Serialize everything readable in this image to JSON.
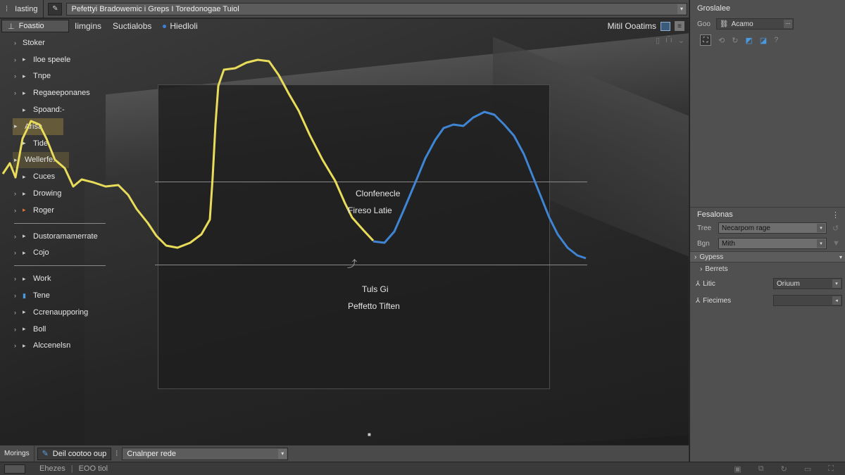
{
  "topbar": {
    "app_label": "Iasting",
    "pin_icon": "pin-icon",
    "title": "Pefettyi Bradowemic i Greps I Toredonogae Tuiol"
  },
  "viewport_tabs": {
    "active_tab": "Foastio",
    "tabs": [
      "Iimgins",
      "Suctialobs",
      "Hiedloli"
    ],
    "right_label": "Mitil Ooatims"
  },
  "tree": {
    "items": [
      {
        "label": "Stoker",
        "arrow": "›"
      },
      {
        "label": "Iloe speele",
        "arrow": "›"
      },
      {
        "label": "Tnpe",
        "arrow": "›"
      },
      {
        "label": "Regaeeponanes",
        "arrow": "›"
      },
      {
        "label": "Spoand:-",
        "arrow": ""
      },
      {
        "label": "Arisa",
        "arrow": "",
        "highlight": true
      },
      {
        "label": "Tide",
        "arrow": ""
      },
      {
        "label": "Wellerfe.",
        "arrow": "",
        "highlight": true
      },
      {
        "label": "Cuces",
        "arrow": "›"
      },
      {
        "label": "Drowing",
        "arrow": "›"
      },
      {
        "label": "Roger",
        "arrow": "›",
        "accent": true
      }
    ],
    "group2": [
      {
        "label": "Dustoramamerrate",
        "arrow": "›"
      },
      {
        "label": "Cojo",
        "arrow": "›"
      }
    ],
    "group3": [
      {
        "label": "Work",
        "arrow": "›"
      },
      {
        "label": "Tene",
        "arrow": "›",
        "blue": true
      },
      {
        "label": "Ccrenaupporing",
        "arrow": "›"
      },
      {
        "label": "Boll",
        "arrow": "›"
      },
      {
        "label": "Alccenelsn",
        "arrow": "›"
      }
    ]
  },
  "center": {
    "line1": "Clonfenecle",
    "line2": "Fireso  Latie",
    "line3": "Tuls Gi",
    "line4": "Peffetto Tiften"
  },
  "right_panel": {
    "header": "Groslalee",
    "field1_label": "Goo",
    "field1_value": "Acamo",
    "section_header": "Fesalonas",
    "tree_label": "Tree",
    "tree_value": "Necarpom rage",
    "bgn_label": "Bgn",
    "bgn_value": "Mith",
    "section_bar": "Gypess",
    "berrets": "Berrets",
    "prop1_label": "Litic",
    "prop1_value": "Oriuum",
    "prop2_label": "Fiecimes",
    "prop2_value": ""
  },
  "bottombar": {
    "label": "Morings",
    "button_label": "Deil cootoo oup",
    "select_value": "Cnalnper rede"
  },
  "statusbar": {
    "text1": "Ehezes",
    "text2": "EOO tiol"
  },
  "colors": {
    "yellow_curve": "#e8dc5a",
    "blue_curve": "#3f85d4",
    "panel": "#505050",
    "viewport_bg": "#2b2b2b"
  }
}
